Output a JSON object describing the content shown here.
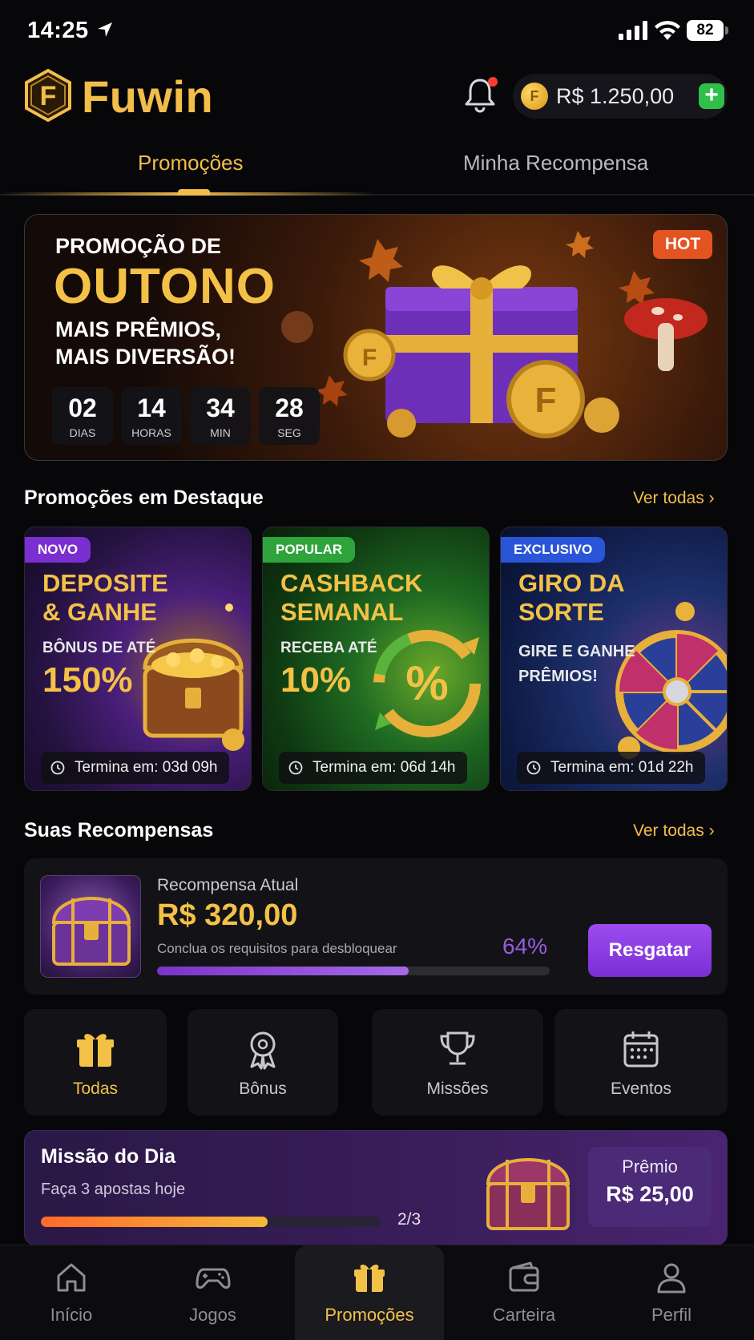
{
  "status_bar": {
    "time": "14:25",
    "battery": "82"
  },
  "header": {
    "logo_letter": "F",
    "logo_text": "Fuwin",
    "balance": "R$ 1.250,00",
    "balance_coin": "F",
    "add_label": "+"
  },
  "tabs": [
    {
      "label": "Promoções",
      "active": true
    },
    {
      "label": "Minha Recompensa",
      "active": false
    }
  ],
  "hero": {
    "line1": "PROMOÇÃO DE",
    "line2": "OUTONO",
    "line3": "MAIS PRÊMIOS,",
    "line4": "MAIS DIVERSÃO!",
    "badge": "HOT",
    "countdown": [
      {
        "value": "02",
        "unit": "DIAS"
      },
      {
        "value": "14",
        "unit": "HORAS"
      },
      {
        "value": "34",
        "unit": "MIN"
      },
      {
        "value": "28",
        "unit": "SEG"
      }
    ]
  },
  "featured": {
    "title": "Promoções em Destaque",
    "see_all": "Ver todas",
    "cards": [
      {
        "badge": "NOVO",
        "badge_color": "#7b2fd0",
        "title1": "DEPOSITE",
        "title2": "& GANHE",
        "sub": "BÔNUS DE ATÉ",
        "big": "150%",
        "ends": "Termina em: 03d 09h"
      },
      {
        "badge": "POPULAR",
        "badge_color": "#2ea43a",
        "title1": "CASHBACK",
        "title2": "SEMANAL",
        "sub": "RECEBA ATÉ",
        "big": "10%",
        "ends": "Termina em: 06d 14h"
      },
      {
        "badge": "EXCLUSIVO",
        "badge_color": "#2b55d8",
        "title1": "GIRO DA",
        "title2": "SORTE",
        "desc1": "GIRE E GANHE",
        "desc2": "PRÊMIOS!",
        "ends": "Termina em: 01d 22h"
      }
    ]
  },
  "rewards": {
    "title": "Suas Recompensas",
    "see_all": "Ver todas",
    "label": "Recompensa Atual",
    "value": "R$ 320,00",
    "hint": "Conclua os requisitos para desbloquear",
    "percent_text": "64%",
    "progress": 0.64,
    "claim_label": "Resgatar"
  },
  "categories": [
    {
      "label": "Todas",
      "icon": "gift-icon",
      "active": true
    },
    {
      "label": "Bônus",
      "icon": "medal-icon",
      "active": false
    },
    {
      "label": "Missões",
      "icon": "trophy-icon",
      "active": false
    },
    {
      "label": "Eventos",
      "icon": "calendar-icon",
      "active": false
    }
  ],
  "mission": {
    "title": "Missão do Dia",
    "desc": "Faça 3 apostas hoje",
    "progress_text": "2/3",
    "progress": 0.6667,
    "prize_label": "Prêmio",
    "prize_value": "R$ 25,00"
  },
  "nav": [
    {
      "label": "Início",
      "icon": "home-icon",
      "active": false
    },
    {
      "label": "Jogos",
      "icon": "gamepad-icon",
      "active": false
    },
    {
      "label": "Promoções",
      "icon": "gift-icon",
      "active": true
    },
    {
      "label": "Carteira",
      "icon": "wallet-icon",
      "active": false
    },
    {
      "label": "Perfil",
      "icon": "user-icon",
      "active": false
    }
  ],
  "colors": {
    "accent": "#f3c146",
    "purple": "#8e3ee6",
    "background": "#07070a"
  }
}
